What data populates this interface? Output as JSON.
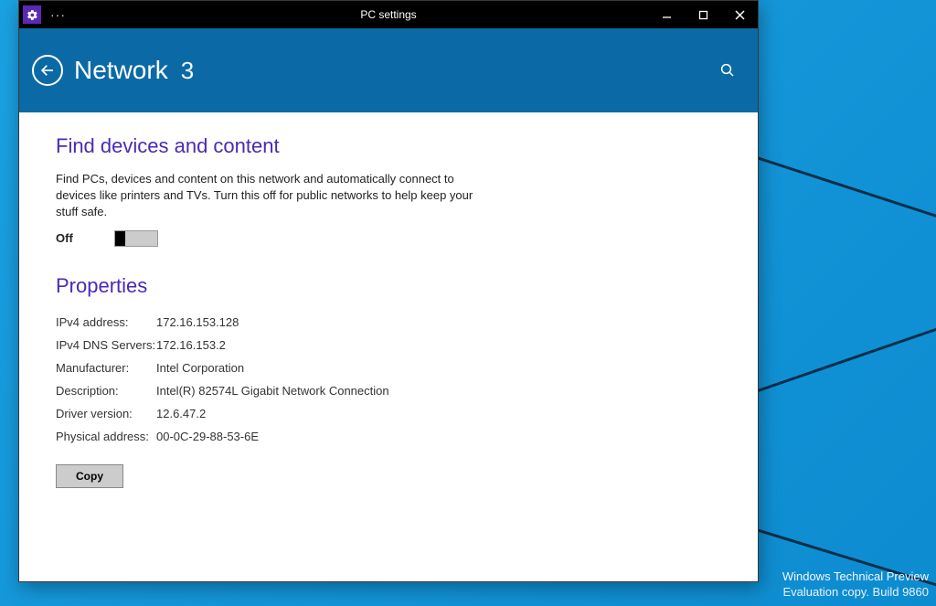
{
  "titlebar": {
    "title": "PC settings",
    "dots": "···"
  },
  "header": {
    "title": "Network",
    "subtitle": "3"
  },
  "find_section": {
    "heading": "Find devices and content",
    "description": "Find PCs, devices and content on this network and automatically connect to devices like printers and TVs. Turn this off for public networks to help keep your stuff safe.",
    "toggle_label": "Off"
  },
  "properties_section": {
    "heading": "Properties",
    "rows": [
      {
        "key": "IPv4 address:",
        "val": "172.16.153.128"
      },
      {
        "key": "IPv4 DNS Servers:",
        "val": "172.16.153.2"
      },
      {
        "key": "Manufacturer:",
        "val": "Intel Corporation"
      },
      {
        "key": "Description:",
        "val": "Intel(R) 82574L Gigabit Network Connection"
      },
      {
        "key": "Driver version:",
        "val": "12.6.47.2"
      },
      {
        "key": "Physical address:",
        "val": "00-0C-29-88-53-6E"
      }
    ],
    "copy_label": "Copy"
  },
  "watermark": {
    "line1": "Windows Technical Preview",
    "line2": "Evaluation copy. Build 9860"
  }
}
